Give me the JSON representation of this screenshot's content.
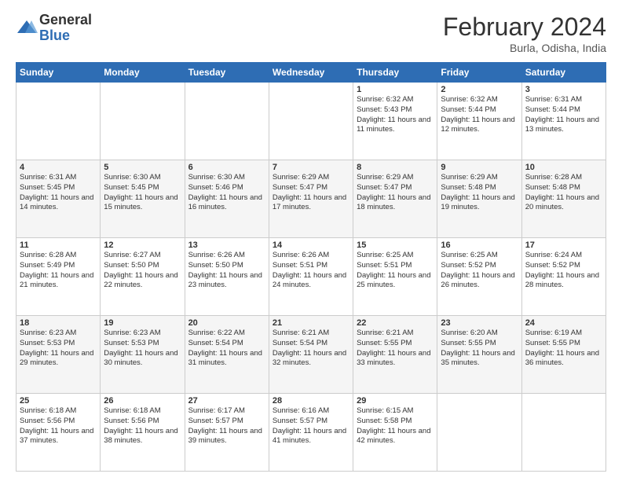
{
  "logo": {
    "general": "General",
    "blue": "Blue"
  },
  "title": "February 2024",
  "location": "Burla, Odisha, India",
  "weekdays": [
    "Sunday",
    "Monday",
    "Tuesday",
    "Wednesday",
    "Thursday",
    "Friday",
    "Saturday"
  ],
  "weeks": [
    [
      {
        "day": "",
        "info": ""
      },
      {
        "day": "",
        "info": ""
      },
      {
        "day": "",
        "info": ""
      },
      {
        "day": "",
        "info": ""
      },
      {
        "day": "1",
        "info": "Sunrise: 6:32 AM\nSunset: 5:43 PM\nDaylight: 11 hours and 11 minutes."
      },
      {
        "day": "2",
        "info": "Sunrise: 6:32 AM\nSunset: 5:44 PM\nDaylight: 11 hours and 12 minutes."
      },
      {
        "day": "3",
        "info": "Sunrise: 6:31 AM\nSunset: 5:44 PM\nDaylight: 11 hours and 13 minutes."
      }
    ],
    [
      {
        "day": "4",
        "info": "Sunrise: 6:31 AM\nSunset: 5:45 PM\nDaylight: 11 hours and 14 minutes."
      },
      {
        "day": "5",
        "info": "Sunrise: 6:30 AM\nSunset: 5:45 PM\nDaylight: 11 hours and 15 minutes."
      },
      {
        "day": "6",
        "info": "Sunrise: 6:30 AM\nSunset: 5:46 PM\nDaylight: 11 hours and 16 minutes."
      },
      {
        "day": "7",
        "info": "Sunrise: 6:29 AM\nSunset: 5:47 PM\nDaylight: 11 hours and 17 minutes."
      },
      {
        "day": "8",
        "info": "Sunrise: 6:29 AM\nSunset: 5:47 PM\nDaylight: 11 hours and 18 minutes."
      },
      {
        "day": "9",
        "info": "Sunrise: 6:29 AM\nSunset: 5:48 PM\nDaylight: 11 hours and 19 minutes."
      },
      {
        "day": "10",
        "info": "Sunrise: 6:28 AM\nSunset: 5:48 PM\nDaylight: 11 hours and 20 minutes."
      }
    ],
    [
      {
        "day": "11",
        "info": "Sunrise: 6:28 AM\nSunset: 5:49 PM\nDaylight: 11 hours and 21 minutes."
      },
      {
        "day": "12",
        "info": "Sunrise: 6:27 AM\nSunset: 5:50 PM\nDaylight: 11 hours and 22 minutes."
      },
      {
        "day": "13",
        "info": "Sunrise: 6:26 AM\nSunset: 5:50 PM\nDaylight: 11 hours and 23 minutes."
      },
      {
        "day": "14",
        "info": "Sunrise: 6:26 AM\nSunset: 5:51 PM\nDaylight: 11 hours and 24 minutes."
      },
      {
        "day": "15",
        "info": "Sunrise: 6:25 AM\nSunset: 5:51 PM\nDaylight: 11 hours and 25 minutes."
      },
      {
        "day": "16",
        "info": "Sunrise: 6:25 AM\nSunset: 5:52 PM\nDaylight: 11 hours and 26 minutes."
      },
      {
        "day": "17",
        "info": "Sunrise: 6:24 AM\nSunset: 5:52 PM\nDaylight: 11 hours and 28 minutes."
      }
    ],
    [
      {
        "day": "18",
        "info": "Sunrise: 6:23 AM\nSunset: 5:53 PM\nDaylight: 11 hours and 29 minutes."
      },
      {
        "day": "19",
        "info": "Sunrise: 6:23 AM\nSunset: 5:53 PM\nDaylight: 11 hours and 30 minutes."
      },
      {
        "day": "20",
        "info": "Sunrise: 6:22 AM\nSunset: 5:54 PM\nDaylight: 11 hours and 31 minutes."
      },
      {
        "day": "21",
        "info": "Sunrise: 6:21 AM\nSunset: 5:54 PM\nDaylight: 11 hours and 32 minutes."
      },
      {
        "day": "22",
        "info": "Sunrise: 6:21 AM\nSunset: 5:55 PM\nDaylight: 11 hours and 33 minutes."
      },
      {
        "day": "23",
        "info": "Sunrise: 6:20 AM\nSunset: 5:55 PM\nDaylight: 11 hours and 35 minutes."
      },
      {
        "day": "24",
        "info": "Sunrise: 6:19 AM\nSunset: 5:55 PM\nDaylight: 11 hours and 36 minutes."
      }
    ],
    [
      {
        "day": "25",
        "info": "Sunrise: 6:18 AM\nSunset: 5:56 PM\nDaylight: 11 hours and 37 minutes."
      },
      {
        "day": "26",
        "info": "Sunrise: 6:18 AM\nSunset: 5:56 PM\nDaylight: 11 hours and 38 minutes."
      },
      {
        "day": "27",
        "info": "Sunrise: 6:17 AM\nSunset: 5:57 PM\nDaylight: 11 hours and 39 minutes."
      },
      {
        "day": "28",
        "info": "Sunrise: 6:16 AM\nSunset: 5:57 PM\nDaylight: 11 hours and 41 minutes."
      },
      {
        "day": "29",
        "info": "Sunrise: 6:15 AM\nSunset: 5:58 PM\nDaylight: 11 hours and 42 minutes."
      },
      {
        "day": "",
        "info": ""
      },
      {
        "day": "",
        "info": ""
      }
    ]
  ]
}
